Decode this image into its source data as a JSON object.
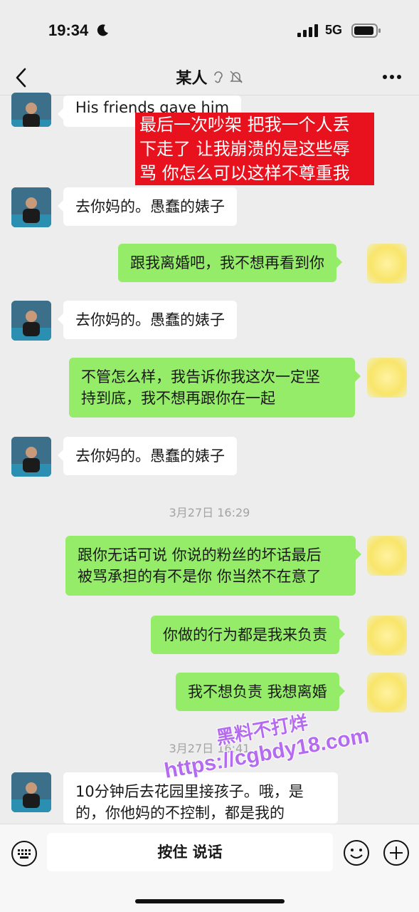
{
  "status": {
    "time": "19:34",
    "network": "5G"
  },
  "nav": {
    "title": "某人",
    "icons": [
      "back-icon",
      "ear-icon",
      "mute-icon",
      "more-icon"
    ]
  },
  "overlay": {
    "text": "最后一次吵架 把我一个人丢\n下走了 让我崩溃的是这些辱\n骂 你怎么可以这样不尊重我"
  },
  "messages": [
    {
      "side": "in",
      "text": "His friends gave him"
    },
    {
      "side": "in",
      "text": "去你妈的。愚蠢的婊子"
    },
    {
      "side": "out",
      "text": "跟我离婚吧，我不想再看到你"
    },
    {
      "side": "in",
      "text": "去你妈的。愚蠢的婊子"
    },
    {
      "side": "out",
      "text": "不管怎么样，我告诉你我这次一定坚\n持到底，我不想再跟你在一起"
    },
    {
      "side": "in",
      "text": "去你妈的。愚蠢的婊子"
    },
    {
      "side": "out",
      "text": "跟你无话可说 你说的粉丝的坏话最后\n被骂承担的有不是你 你当然不在意了"
    },
    {
      "side": "out",
      "text": "你做的行为都是我来负责"
    },
    {
      "side": "out",
      "text": "我不想负责 我想离婚"
    },
    {
      "side": "in",
      "text": "10分钟后去花园里接孩子。哦，是\n的，你他妈的不控制，都是我的"
    }
  ],
  "timestamps": [
    "3月27日 16:29",
    "3月27日 16:41"
  ],
  "watermark": {
    "line1": "黑料不打烊",
    "line2": "https://cgbdy18.com"
  },
  "input": {
    "voice_label": "按住 说话"
  },
  "colors": {
    "background": "#ededed",
    "outgoing_bubble": "#95ec69",
    "incoming_bubble": "#ffffff",
    "overlay_red": "#e8121f",
    "watermark": "#b56bf0"
  }
}
